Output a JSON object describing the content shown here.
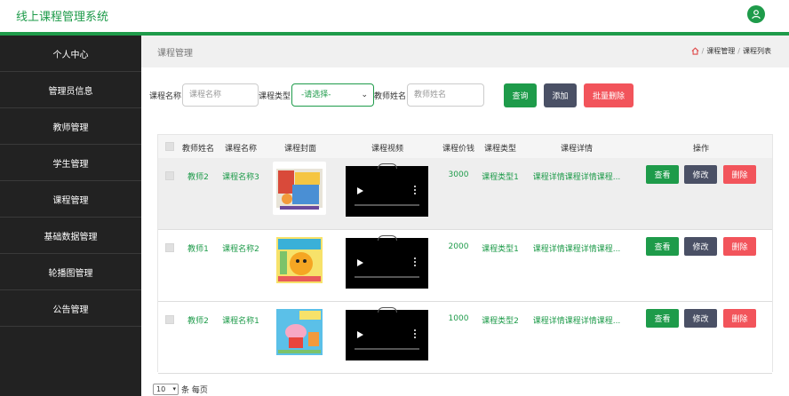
{
  "app": {
    "title": "线上课程管理系统"
  },
  "sidebar": {
    "items": [
      {
        "label": "个人中心"
      },
      {
        "label": "管理员信息"
      },
      {
        "label": "教师管理"
      },
      {
        "label": "学生管理"
      },
      {
        "label": "课程管理"
      },
      {
        "label": "基础数据管理"
      },
      {
        "label": "轮播图管理"
      },
      {
        "label": "公告管理"
      }
    ]
  },
  "header": {
    "page_title": "课程管理",
    "breadcrumb": [
      "课程管理",
      "课程列表"
    ]
  },
  "search": {
    "course_name_label": "课程名称",
    "course_name_placeholder": "课程名称",
    "course_type_label": "课程类型",
    "course_type_selected": "-请选择-",
    "teacher_name_label": "教师姓名",
    "teacher_name_placeholder": "教师姓名",
    "query_label": "查询",
    "add_label": "添加",
    "batch_delete_label": "批量删除"
  },
  "colors": {
    "accent": "#1e9b4a",
    "edit": "#4a5065",
    "danger": "#f2545b",
    "sidebar": "#222222"
  },
  "table": {
    "headers": [
      "教师姓名",
      "课程名称",
      "课程封面",
      "课程视频",
      "课程价钱",
      "课程类型",
      "课程详情",
      "操作"
    ],
    "rows": [
      {
        "teacher": "教师2",
        "name": "课程名称3",
        "price": "3000",
        "type": "课程类型1",
        "detail": "课程详情课程详情课程..."
      },
      {
        "teacher": "教师1",
        "name": "课程名称2",
        "price": "2000",
        "type": "课程类型1",
        "detail": "课程详情课程详情课程..."
      },
      {
        "teacher": "教师2",
        "name": "课程名称1",
        "price": "1000",
        "type": "课程类型2",
        "detail": "课程详情课程详情课程..."
      }
    ],
    "actions": {
      "view": "查看",
      "edit": "修改",
      "delete": "删除"
    }
  },
  "pager": {
    "page_size": "10",
    "suffix": "条 每页"
  }
}
